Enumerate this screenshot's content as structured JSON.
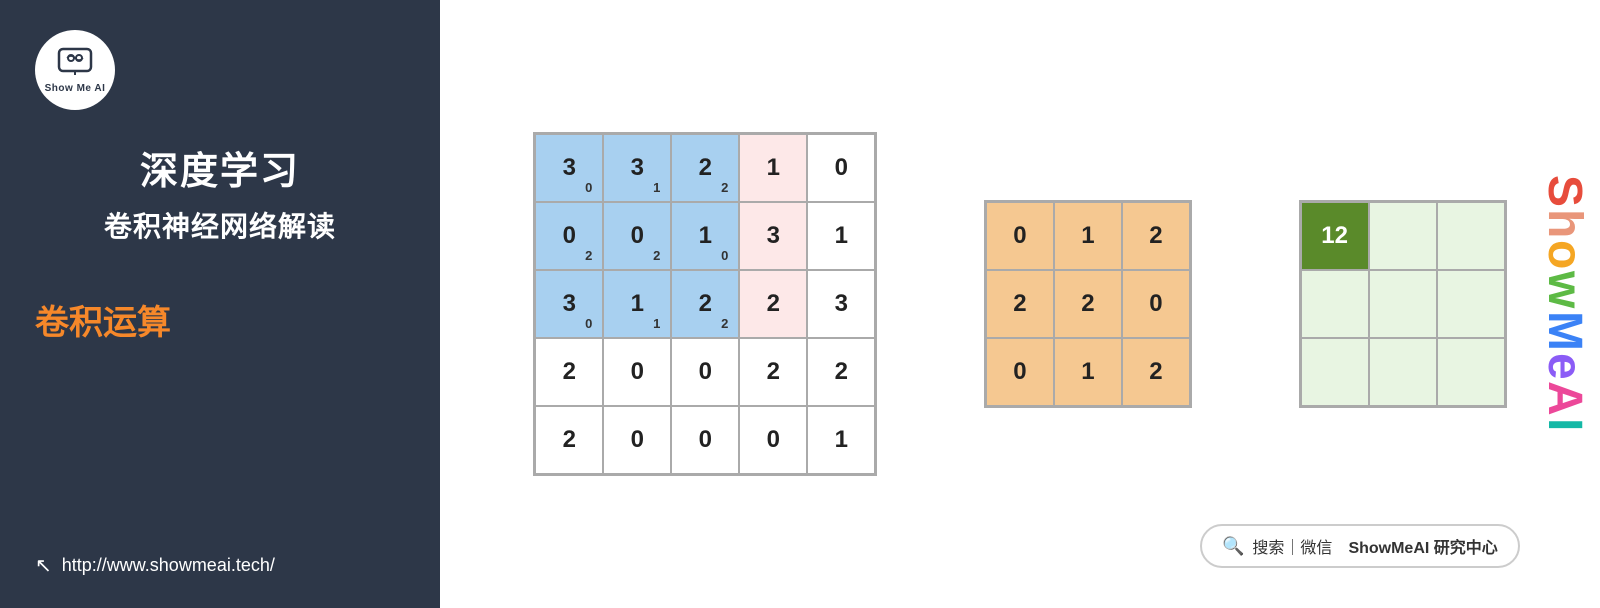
{
  "left": {
    "logo_alt": "ShowMeAI",
    "logo_icon": "▲ I",
    "logo_subtext": "Show Me AI",
    "main_title": "深度学习",
    "sub_title": "卷积神经网络解读",
    "highlight_label": "卷积运算",
    "url": "http://www.showmeai.tech/"
  },
  "input_matrix": {
    "rows": [
      [
        {
          "v": "3",
          "s": "0",
          "type": "blue_dark"
        },
        {
          "v": "3",
          "s": "1",
          "type": "blue_dark"
        },
        {
          "v": "2",
          "s": "2",
          "type": "blue_dark"
        },
        {
          "v": "1",
          "s": "",
          "type": "pink"
        },
        {
          "v": "0",
          "s": "",
          "type": "white"
        }
      ],
      [
        {
          "v": "0",
          "s": "2",
          "type": "blue_dark"
        },
        {
          "v": "0",
          "s": "2",
          "type": "blue_dark"
        },
        {
          "v": "1",
          "s": "0",
          "type": "blue_dark"
        },
        {
          "v": "3",
          "s": "",
          "type": "pink"
        },
        {
          "v": "1",
          "s": "",
          "type": "white"
        }
      ],
      [
        {
          "v": "3",
          "s": "0",
          "type": "blue_dark"
        },
        {
          "v": "1",
          "s": "1",
          "type": "blue_dark"
        },
        {
          "v": "2",
          "s": "2",
          "type": "blue_dark"
        },
        {
          "v": "2",
          "s": "",
          "type": "pink"
        },
        {
          "v": "3",
          "s": "",
          "type": "white"
        }
      ],
      [
        {
          "v": "2",
          "s": "",
          "type": "white"
        },
        {
          "v": "0",
          "s": "",
          "type": "white"
        },
        {
          "v": "0",
          "s": "",
          "type": "white"
        },
        {
          "v": "2",
          "s": "",
          "type": "white"
        },
        {
          "v": "2",
          "s": "",
          "type": "white"
        }
      ],
      [
        {
          "v": "2",
          "s": "",
          "type": "white"
        },
        {
          "v": "0",
          "s": "",
          "type": "white"
        },
        {
          "v": "0",
          "s": "",
          "type": "white"
        },
        {
          "v": "0",
          "s": "",
          "type": "white"
        },
        {
          "v": "1",
          "s": "",
          "type": "white"
        }
      ]
    ]
  },
  "kernel_matrix": {
    "rows": [
      [
        {
          "v": "0"
        },
        {
          "v": "1"
        },
        {
          "v": "2"
        }
      ],
      [
        {
          "v": "2"
        },
        {
          "v": "2"
        },
        {
          "v": "0"
        }
      ],
      [
        {
          "v": "0"
        },
        {
          "v": "1"
        },
        {
          "v": "2"
        }
      ]
    ]
  },
  "output_matrix": {
    "rows": [
      [
        {
          "v": "12",
          "type": "dark_green"
        },
        {
          "v": "",
          "type": "light_green"
        },
        {
          "v": "",
          "type": "light_green"
        }
      ],
      [
        {
          "v": "",
          "type": "light_green"
        },
        {
          "v": "",
          "type": "light_green"
        },
        {
          "v": "",
          "type": "light_green"
        }
      ],
      [
        {
          "v": "",
          "type": "light_green"
        },
        {
          "v": "",
          "type": "light_green"
        },
        {
          "v": "",
          "type": "light_green"
        }
      ]
    ]
  },
  "vertical_text": "ShowMeAI",
  "search": {
    "icon": "🔍",
    "prefix": "搜索｜微信",
    "brand": "ShowMeAI 研究中心"
  }
}
